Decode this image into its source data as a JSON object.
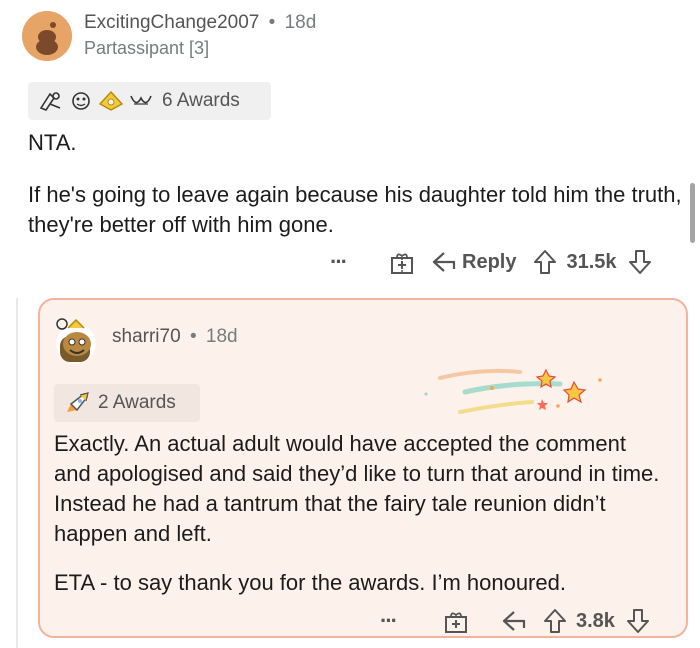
{
  "comment": {
    "username": "ExcitingChange2007",
    "age": "18d",
    "flair": "Partassipant [3]",
    "awards_label": "6 Awards",
    "text_line1": "NTA.",
    "text_para2": "If he's going to leave again because his daughter told him the truth, they're better off with him gone.",
    "more": "···",
    "reply_label": "Reply",
    "score": "31.5k"
  },
  "reply": {
    "username": "sharri70",
    "age": "18d",
    "awards_label": "2 Awards",
    "text_para1": "Exactly. An actual adult would have accepted the comment and apologised and said they’d like to turn that around in time. Instead he had a tantrum that the fairy tale reunion didn’t happen and left.",
    "text_para2": "ETA - to say thank you for the awards. I’m honoured.",
    "more": "···",
    "score": "3.8k"
  },
  "separator": "•",
  "colors": {
    "reply_bg": "#fdf1eb",
    "reply_border": "#f2b49b",
    "avatar": "#e6a567"
  }
}
